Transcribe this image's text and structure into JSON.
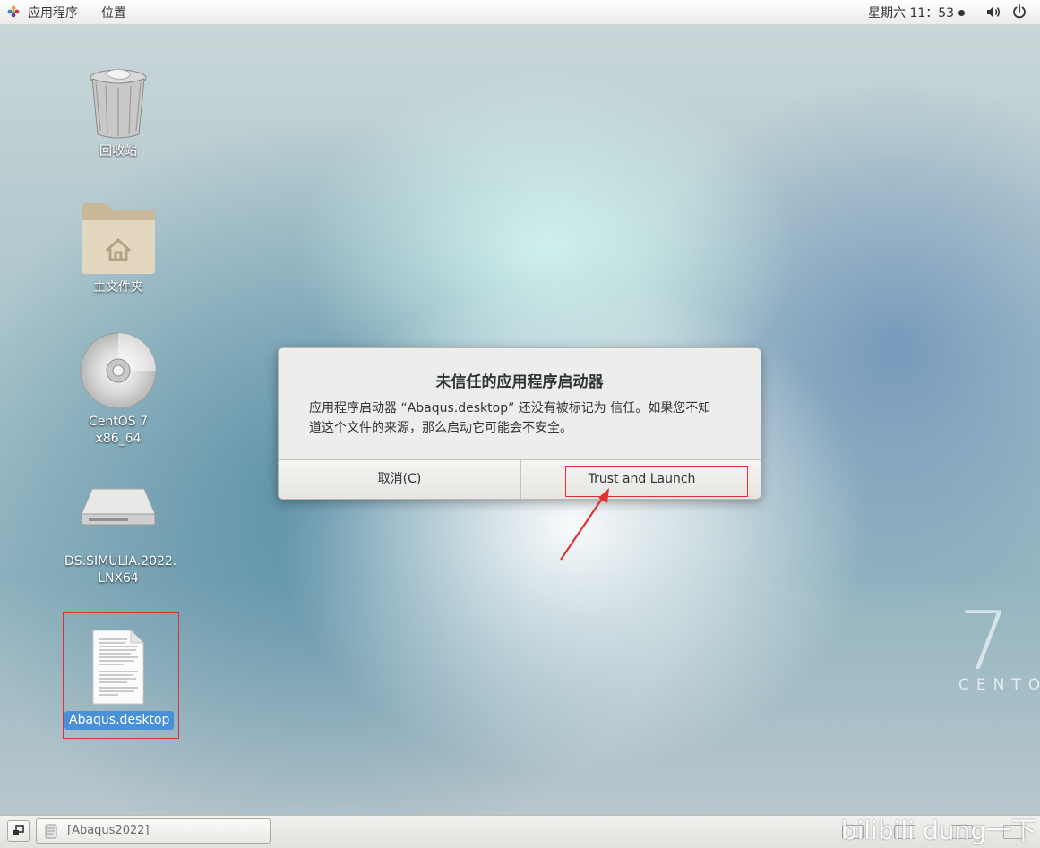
{
  "topbar": {
    "applications": "应用程序",
    "places": "位置",
    "clock": "星期六 11：53"
  },
  "desktop": {
    "icons": [
      {
        "label": "回收站",
        "icon": "trash-icon"
      },
      {
        "label": "主文件夹",
        "icon": "home-folder-icon"
      },
      {
        "label": "CentOS 7 x86_64",
        "icon": "cdrom-icon"
      },
      {
        "label": "DS.SIMULIA.2022.",
        "label2": "LNX64",
        "icon": "drive-icon"
      },
      {
        "label": "Abaqus.desktop",
        "icon": "text-file-icon"
      }
    ],
    "watermark_brand": "7",
    "watermark_text": "CENTO"
  },
  "dialog": {
    "title": "未信任的应用程序启动器",
    "message_line1": "应用程序启动器 “Abaqus.desktop” 还没有被标记为 信任。如果您不知",
    "message_line2": "道这个文件的来源，那么启动它可能会不安全。",
    "cancel_label": "取消(C)",
    "trust_label": "Trust and Launch"
  },
  "taskbar": {
    "window_label": "[Abaqus2022]"
  },
  "overlay": {
    "watermark": "bilibili dung一下"
  },
  "colors": {
    "annotation": "#e03030",
    "selection": "#4a90d9"
  }
}
